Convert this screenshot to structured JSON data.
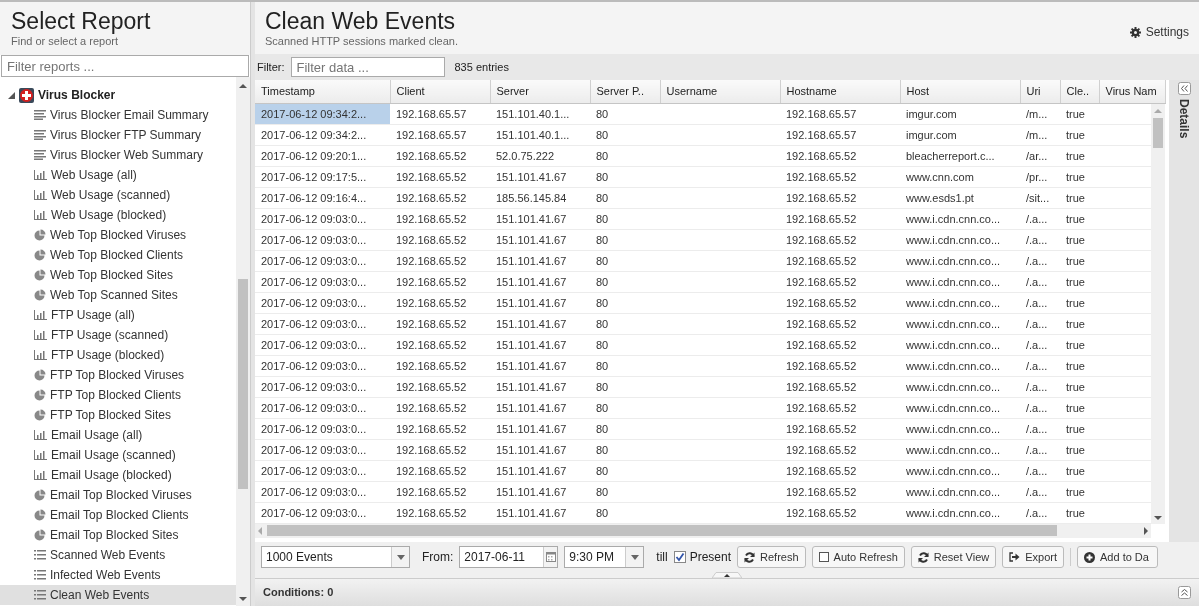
{
  "sidebar": {
    "title": "Select Report",
    "subtitle": "Find or select a report",
    "filter": {
      "placeholder": "Filter reports ..."
    },
    "tree": [
      {
        "label": "Virus Blocker",
        "kind": "app",
        "expanded": true,
        "children": [
          {
            "label": "Virus Blocker Email Summary",
            "kind": "summary",
            "selected": false
          },
          {
            "label": "Virus Blocker FTP Summary",
            "kind": "summary",
            "selected": false
          },
          {
            "label": "Virus Blocker Web Summary",
            "kind": "summary",
            "selected": false
          },
          {
            "label": "Web Usage (all)",
            "kind": "bar",
            "selected": false
          },
          {
            "label": "Web Usage (scanned)",
            "kind": "bar",
            "selected": false
          },
          {
            "label": "Web Usage (blocked)",
            "kind": "bar",
            "selected": false
          },
          {
            "label": "Web Top Blocked Viruses",
            "kind": "pie",
            "selected": false
          },
          {
            "label": "Web Top Blocked Clients",
            "kind": "pie",
            "selected": false
          },
          {
            "label": "Web Top Blocked Sites",
            "kind": "pie",
            "selected": false
          },
          {
            "label": "Web Top Scanned Sites",
            "kind": "pie",
            "selected": false
          },
          {
            "label": "FTP Usage (all)",
            "kind": "bar",
            "selected": false
          },
          {
            "label": "FTP Usage (scanned)",
            "kind": "bar",
            "selected": false
          },
          {
            "label": "FTP Usage (blocked)",
            "kind": "bar",
            "selected": false
          },
          {
            "label": "FTP Top Blocked Viruses",
            "kind": "pie",
            "selected": false
          },
          {
            "label": "FTP Top Blocked Clients",
            "kind": "pie",
            "selected": false
          },
          {
            "label": "FTP Top Blocked Sites",
            "kind": "pie",
            "selected": false
          },
          {
            "label": "Email Usage (all)",
            "kind": "bar",
            "selected": false
          },
          {
            "label": "Email Usage (scanned)",
            "kind": "bar",
            "selected": false
          },
          {
            "label": "Email Usage (blocked)",
            "kind": "bar",
            "selected": false
          },
          {
            "label": "Email Top Blocked Viruses",
            "kind": "pie",
            "selected": false
          },
          {
            "label": "Email Top Blocked Clients",
            "kind": "pie",
            "selected": false
          },
          {
            "label": "Email Top Blocked Sites",
            "kind": "pie",
            "selected": false
          },
          {
            "label": "Scanned Web Events",
            "kind": "list",
            "selected": false
          },
          {
            "label": "Infected Web Events",
            "kind": "list",
            "selected": false
          },
          {
            "label": "Clean Web Events",
            "kind": "list",
            "selected": true
          }
        ]
      }
    ]
  },
  "main": {
    "title": "Clean Web Events",
    "subtitle": "Scanned HTTP sessions marked clean.",
    "settings": "Settings",
    "filter": {
      "label": "Filter:",
      "placeholder": "Filter data ..."
    },
    "entries": "835 entries",
    "table": {
      "columns": [
        "Timestamp",
        "Client",
        "Server",
        "Server P..",
        "Username",
        "Hostname",
        "Host",
        "Uri",
        "Cle..",
        "Virus Nam"
      ],
      "rows": [
        {
          "selected": true,
          "cells": [
            "2017-06-12 09:34:2...",
            "192.168.65.57",
            "151.101.40.1...",
            "80",
            "",
            "192.168.65.57",
            "imgur.com",
            "/m...",
            "true",
            ""
          ]
        },
        {
          "selected": false,
          "cells": [
            "2017-06-12 09:34:2...",
            "192.168.65.57",
            "151.101.40.1...",
            "80",
            "",
            "192.168.65.57",
            "imgur.com",
            "/m...",
            "true",
            ""
          ]
        },
        {
          "selected": false,
          "cells": [
            "2017-06-12 09:20:1...",
            "192.168.65.52",
            "52.0.75.222",
            "80",
            "",
            "192.168.65.52",
            "bleacherreport.c...",
            "/ar...",
            "true",
            ""
          ]
        },
        {
          "selected": false,
          "cells": [
            "2017-06-12 09:17:5...",
            "192.168.65.52",
            "151.101.41.67",
            "80",
            "",
            "192.168.65.52",
            "www.cnn.com",
            "/pr...",
            "true",
            ""
          ]
        },
        {
          "selected": false,
          "cells": [
            "2017-06-12 09:16:4...",
            "192.168.65.52",
            "185.56.145.84",
            "80",
            "",
            "192.168.65.52",
            "www.esds1.pt",
            "/sit...",
            "true",
            ""
          ]
        },
        {
          "selected": false,
          "cells": [
            "2017-06-12 09:03:0...",
            "192.168.65.52",
            "151.101.41.67",
            "80",
            "",
            "192.168.65.52",
            "www.i.cdn.cnn.co...",
            "/.a...",
            "true",
            ""
          ]
        },
        {
          "selected": false,
          "cells": [
            "2017-06-12 09:03:0...",
            "192.168.65.52",
            "151.101.41.67",
            "80",
            "",
            "192.168.65.52",
            "www.i.cdn.cnn.co...",
            "/.a...",
            "true",
            ""
          ]
        },
        {
          "selected": false,
          "cells": [
            "2017-06-12 09:03:0...",
            "192.168.65.52",
            "151.101.41.67",
            "80",
            "",
            "192.168.65.52",
            "www.i.cdn.cnn.co...",
            "/.a...",
            "true",
            ""
          ]
        },
        {
          "selected": false,
          "cells": [
            "2017-06-12 09:03:0...",
            "192.168.65.52",
            "151.101.41.67",
            "80",
            "",
            "192.168.65.52",
            "www.i.cdn.cnn.co...",
            "/.a...",
            "true",
            ""
          ]
        },
        {
          "selected": false,
          "cells": [
            "2017-06-12 09:03:0...",
            "192.168.65.52",
            "151.101.41.67",
            "80",
            "",
            "192.168.65.52",
            "www.i.cdn.cnn.co...",
            "/.a...",
            "true",
            ""
          ]
        },
        {
          "selected": false,
          "cells": [
            "2017-06-12 09:03:0...",
            "192.168.65.52",
            "151.101.41.67",
            "80",
            "",
            "192.168.65.52",
            "www.i.cdn.cnn.co...",
            "/.a...",
            "true",
            ""
          ]
        },
        {
          "selected": false,
          "cells": [
            "2017-06-12 09:03:0...",
            "192.168.65.52",
            "151.101.41.67",
            "80",
            "",
            "192.168.65.52",
            "www.i.cdn.cnn.co...",
            "/.a...",
            "true",
            ""
          ]
        },
        {
          "selected": false,
          "cells": [
            "2017-06-12 09:03:0...",
            "192.168.65.52",
            "151.101.41.67",
            "80",
            "",
            "192.168.65.52",
            "www.i.cdn.cnn.co...",
            "/.a...",
            "true",
            ""
          ]
        },
        {
          "selected": false,
          "cells": [
            "2017-06-12 09:03:0...",
            "192.168.65.52",
            "151.101.41.67",
            "80",
            "",
            "192.168.65.52",
            "www.i.cdn.cnn.co...",
            "/.a...",
            "true",
            ""
          ]
        },
        {
          "selected": false,
          "cells": [
            "2017-06-12 09:03:0...",
            "192.168.65.52",
            "151.101.41.67",
            "80",
            "",
            "192.168.65.52",
            "www.i.cdn.cnn.co...",
            "/.a...",
            "true",
            ""
          ]
        },
        {
          "selected": false,
          "cells": [
            "2017-06-12 09:03:0...",
            "192.168.65.52",
            "151.101.41.67",
            "80",
            "",
            "192.168.65.52",
            "www.i.cdn.cnn.co...",
            "/.a...",
            "true",
            ""
          ]
        },
        {
          "selected": false,
          "cells": [
            "2017-06-12 09:03:0...",
            "192.168.65.52",
            "151.101.41.67",
            "80",
            "",
            "192.168.65.52",
            "www.i.cdn.cnn.co...",
            "/.a...",
            "true",
            ""
          ]
        },
        {
          "selected": false,
          "cells": [
            "2017-06-12 09:03:0...",
            "192.168.65.52",
            "151.101.41.67",
            "80",
            "",
            "192.168.65.52",
            "www.i.cdn.cnn.co...",
            "/.a...",
            "true",
            ""
          ]
        },
        {
          "selected": false,
          "cells": [
            "2017-06-12 09:03:0...",
            "192.168.65.52",
            "151.101.41.67",
            "80",
            "",
            "192.168.65.52",
            "www.i.cdn.cnn.co...",
            "/.a...",
            "true",
            ""
          ]
        },
        {
          "selected": false,
          "cells": [
            "2017-06-12 09:03:0...",
            "192.168.65.52",
            "151.101.41.67",
            "80",
            "",
            "192.168.65.52",
            "www.i.cdn.cnn.co...",
            "/.a...",
            "true",
            ""
          ]
        }
      ]
    },
    "toolbar": {
      "limit": "1000 Events",
      "from_label": "From:",
      "date": "2017-06-11",
      "time": "9:30 PM",
      "till_label": "till",
      "present": {
        "label": "Present",
        "checked": true
      },
      "buttons": [
        {
          "label": "Refresh",
          "kind": "refresh"
        },
        {
          "label": "Auto Refresh",
          "kind": "toggle",
          "checked": false
        },
        {
          "label": "Reset View",
          "kind": "reset"
        },
        {
          "label": "Export",
          "kind": "export"
        },
        {
          "label": "Add to Da",
          "kind": "add"
        }
      ]
    },
    "conditions": "Conditions: 0",
    "details": "Details"
  }
}
